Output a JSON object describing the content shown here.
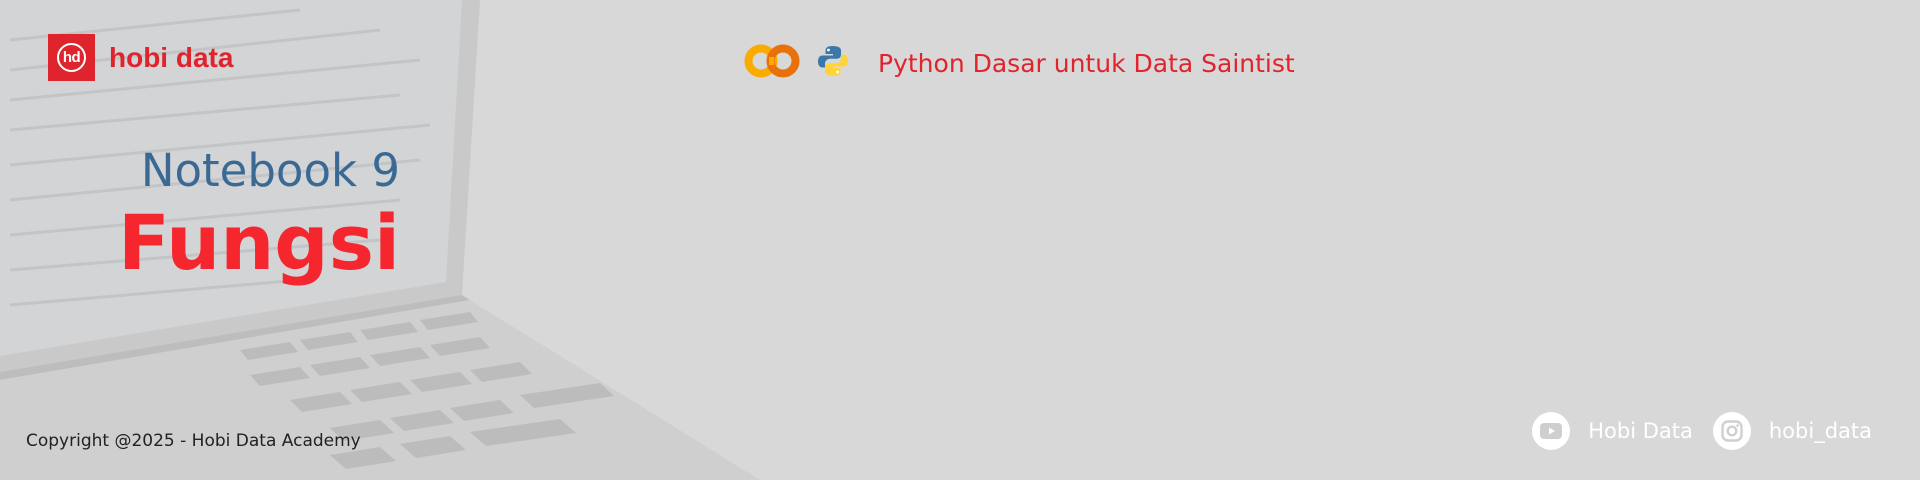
{
  "brand": {
    "logo_mark": "hd",
    "name": "hobi data",
    "accent": "#e0242d"
  },
  "course": {
    "title": "Python Dasar untuk Data Saintist",
    "icons": [
      "colab-icon",
      "python-icon"
    ]
  },
  "notebook": {
    "label": "Notebook 9",
    "title": "Fungsi",
    "label_color": "#3a6a94",
    "title_color": "#f5262d"
  },
  "footer": {
    "copyright": "Copyright @2025 - Hobi Data Academy"
  },
  "social": [
    {
      "icon": "youtube-icon",
      "label": "Hobi Data"
    },
    {
      "icon": "instagram-icon",
      "label": "hobi_data"
    }
  ]
}
